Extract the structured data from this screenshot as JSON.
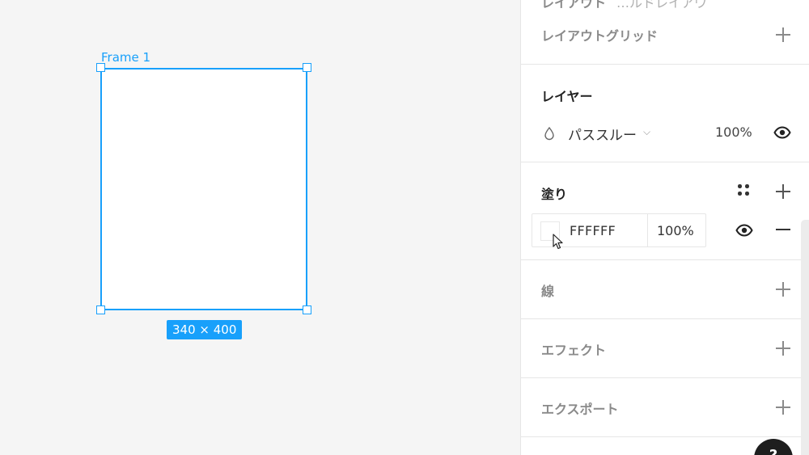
{
  "canvas": {
    "frame_label": "Frame 1",
    "size_badge": "340 × 400"
  },
  "panel": {
    "cut_section": {
      "title": "レイアウト",
      "subtitle": "…ルドレイアウ"
    },
    "layout_grid": {
      "title": "レイアウトグリッド",
      "icon": "plus-icon"
    },
    "layer": {
      "title": "レイヤー",
      "blend_mode": "パススルー",
      "opacity": "100%"
    },
    "fill": {
      "title": "塗り",
      "hex": "FFFFFF",
      "opacity": "100%",
      "swatch_color": "#FFFFFF"
    },
    "stroke": {
      "title": "線"
    },
    "effect": {
      "title": "エフェクト"
    },
    "export": {
      "title": "エクスポート"
    },
    "help": "?"
  },
  "colors": {
    "accent": "#18A0FB",
    "canvas_bg": "#F5F5F5",
    "panel_bg": "#FFFFFF"
  }
}
